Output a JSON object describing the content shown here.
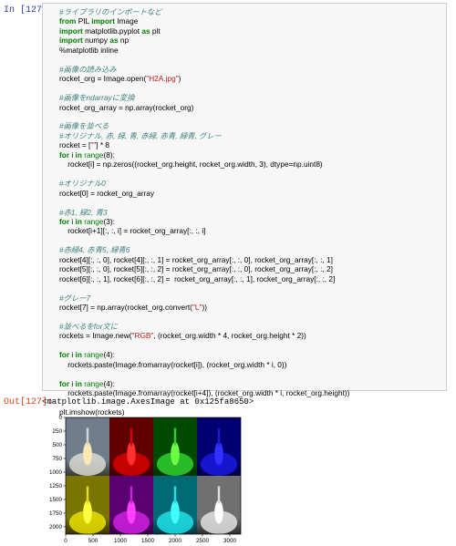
{
  "prompt_in": "In [127]:",
  "prompt_out": "Out[127]:",
  "code_lines": [
    [
      {
        "t": "#ライブラリのインポートなど",
        "c": "c"
      }
    ],
    [
      {
        "t": "from",
        "c": "k"
      },
      {
        "t": " PIL "
      },
      {
        "t": "import",
        "c": "k"
      },
      {
        "t": " Image"
      }
    ],
    [
      {
        "t": "import",
        "c": "k"
      },
      {
        "t": " matplotlib.pyplot "
      },
      {
        "t": "as",
        "c": "k"
      },
      {
        "t": " plt"
      }
    ],
    [
      {
        "t": "import",
        "c": "k"
      },
      {
        "t": " numpy "
      },
      {
        "t": "as",
        "c": "k"
      },
      {
        "t": " np"
      }
    ],
    [
      {
        "t": "%matplotlib inline"
      }
    ],
    [],
    [
      {
        "t": "#画像の読み込み",
        "c": "c"
      }
    ],
    [
      {
        "t": "rocket_org = Image.open("
      },
      {
        "t": "\"H2A.jpg\"",
        "c": "s"
      },
      {
        "t": ")"
      }
    ],
    [],
    [
      {
        "t": "#画像をndarrayに変換",
        "c": "c"
      }
    ],
    [
      {
        "t": "rocket_org_array = np.array(rocket_org)"
      }
    ],
    [],
    [
      {
        "t": "#画像を並べる",
        "c": "c"
      }
    ],
    [
      {
        "t": "#オリジナル, 赤, 緑, 青, 赤緑, 赤青, 緑青, グレー",
        "c": "c"
      }
    ],
    [
      {
        "t": "rocket = ["
      },
      {
        "t": "\"\"",
        "c": "s"
      },
      {
        "t": "] * 8"
      }
    ],
    [
      {
        "t": "for",
        "c": "k"
      },
      {
        "t": " i "
      },
      {
        "t": "in",
        "c": "k"
      },
      {
        "t": " "
      },
      {
        "t": "range",
        "c": "n"
      },
      {
        "t": "(8):"
      }
    ],
    [
      {
        "t": "    rocket[i] = np.zeros((rocket_org.height, rocket_org.width, 3), dtype=np.uint8)"
      }
    ],
    [],
    [
      {
        "t": "#オリジナル0",
        "c": "c"
      }
    ],
    [
      {
        "t": "rocket[0] = rocket_org_array"
      }
    ],
    [],
    [
      {
        "t": "#赤1, 緑2, 青3",
        "c": "c"
      }
    ],
    [
      {
        "t": "for",
        "c": "k"
      },
      {
        "t": " i "
      },
      {
        "t": "in",
        "c": "k"
      },
      {
        "t": " "
      },
      {
        "t": "range",
        "c": "n"
      },
      {
        "t": "(3):"
      }
    ],
    [
      {
        "t": "    rocket[i+1][:, :, i] = rocket_org_array[:, :, i]"
      }
    ],
    [],
    [
      {
        "t": "#赤緑4, 赤青5, 緑青6",
        "c": "c"
      }
    ],
    [
      {
        "t": "rocket[4][:, :, 0], rocket[4][:, :, 1] = rocket_org_array[:, :, 0], rocket_org_array[:, :, 1]"
      }
    ],
    [
      {
        "t": "rocket[5][:, :, 0], rocket[5][:, :, 2] = rocket_org_array[:, :, 0], rocket_org_array[:, :, 2]"
      }
    ],
    [
      {
        "t": "rocket[6][:, :, 1], rocket[6][:, :, 2] =  rocket_org_array[:, :, 1], rocket_org_array[:, :, 2]"
      }
    ],
    [],
    [
      {
        "t": "#グレー7",
        "c": "c"
      }
    ],
    [
      {
        "t": "rocket[7] = np.array(rocket_org.convert("
      },
      {
        "t": "\"L\"",
        "c": "s"
      },
      {
        "t": "))"
      }
    ],
    [],
    [
      {
        "t": "#並べるをfor文に",
        "c": "c"
      }
    ],
    [
      {
        "t": "rockets = Image.new("
      },
      {
        "t": "\"RGB\"",
        "c": "s"
      },
      {
        "t": ", (rocket_org.width * 4, rocket_org.height * 2))"
      }
    ],
    [],
    [
      {
        "t": "for",
        "c": "k"
      },
      {
        "t": " i "
      },
      {
        "t": "in",
        "c": "k"
      },
      {
        "t": " "
      },
      {
        "t": "range",
        "c": "n"
      },
      {
        "t": "(4):"
      }
    ],
    [
      {
        "t": "    rockets.paste(Image.fromarray(rocket[i]), (rocket_org.width * i, 0))"
      }
    ],
    [],
    [
      {
        "t": "for",
        "c": "k"
      },
      {
        "t": " i "
      },
      {
        "t": "in",
        "c": "k"
      },
      {
        "t": " "
      },
      {
        "t": "range",
        "c": "n"
      },
      {
        "t": "(4):"
      }
    ],
    [
      {
        "t": "    rockets.paste(Image.fromarray(rocket[i+4]), (rocket_org.width * i, rocket_org.height))"
      }
    ],
    [],
    [
      {
        "t": "plt.imshow(rockets)"
      }
    ]
  ],
  "output_text": "<matplotlib.image.AxesImage at 0x125fa8650>",
  "plot": {
    "x_ticks": [
      "0",
      "500",
      "1000",
      "1500",
      "2000",
      "2500",
      "3000"
    ],
    "x_tick_values": [
      0,
      500,
      1000,
      1500,
      2000,
      2500,
      3000
    ],
    "y_ticks": [
      "0",
      "250",
      "500",
      "750",
      "1000",
      "1250",
      "1500",
      "1750",
      "2000"
    ],
    "y_tick_values": [
      0,
      250,
      500,
      750,
      1000,
      1250,
      1500,
      1750,
      2000
    ],
    "x_max": 3200,
    "y_max": 2134,
    "panels": [
      {
        "name": "original",
        "sky": "#6f7d8c",
        "smoke": "#d8d8d0",
        "rocket": "#ffe8b0",
        "ground": "#3a3a32"
      },
      {
        "name": "red",
        "sky": "#600000",
        "smoke": "#d80000",
        "rocket": "#ff3030",
        "ground": "#3a0000"
      },
      {
        "name": "green",
        "sky": "#004a00",
        "smoke": "#30d030",
        "rocket": "#70ff40",
        "ground": "#003300"
      },
      {
        "name": "blue",
        "sky": "#000070",
        "smoke": "#1a1ae0",
        "rocket": "#3030ff",
        "ground": "#000044"
      },
      {
        "name": "red-green",
        "sky": "#7a7400",
        "smoke": "#e8e000",
        "rocket": "#ffff40",
        "ground": "#3a3300"
      },
      {
        "name": "red-blue",
        "sky": "#5a0070",
        "smoke": "#d020e0",
        "rocket": "#ff40ff",
        "ground": "#330044"
      },
      {
        "name": "green-blue",
        "sky": "#006a74",
        "smoke": "#20e0e8",
        "rocket": "#40ffff",
        "ground": "#003344"
      },
      {
        "name": "gray",
        "sky": "#707070",
        "smoke": "#e0e0e0",
        "rocket": "#ffffff",
        "ground": "#2e2e2e"
      }
    ]
  }
}
